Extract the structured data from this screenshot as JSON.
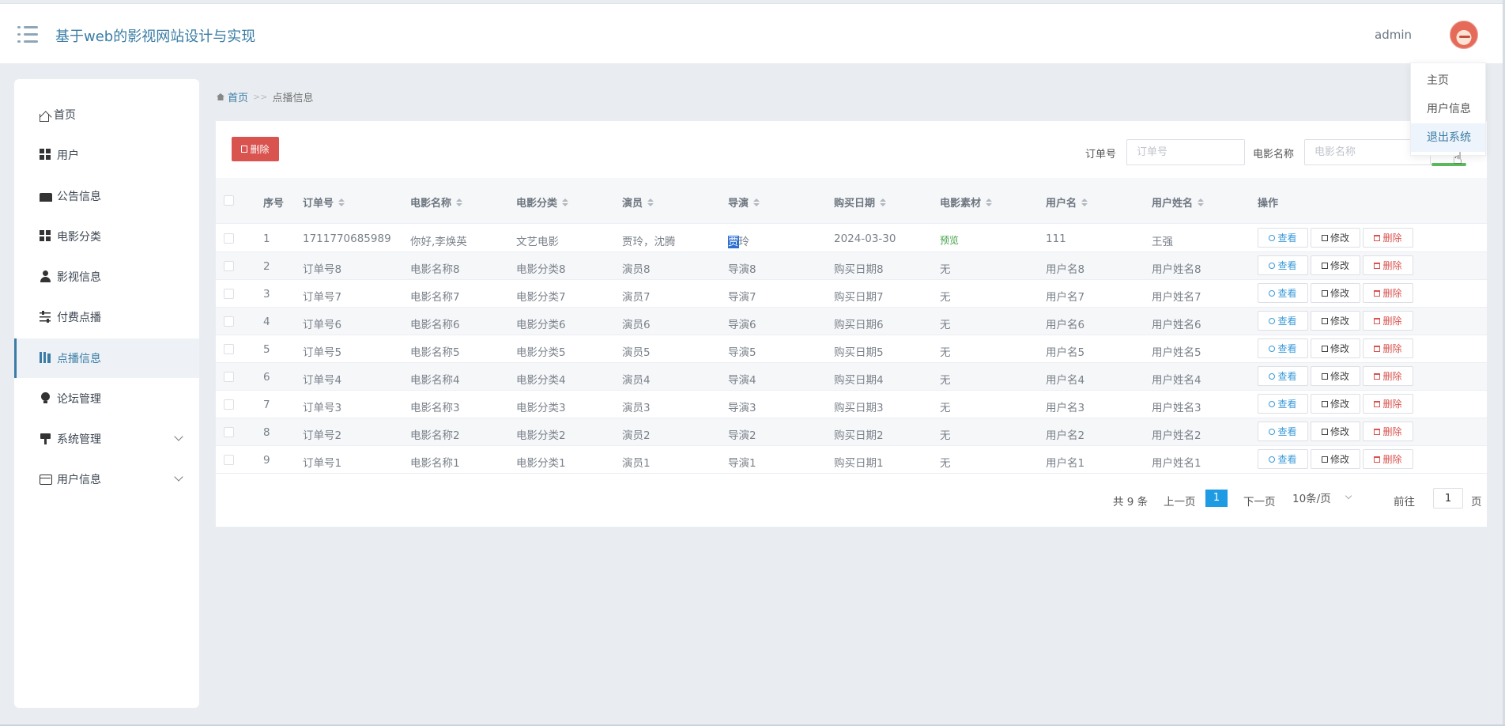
{
  "header": {
    "title": "基于web的影视网站设计与实现",
    "username": "admin"
  },
  "dropdown": {
    "items": [
      "主页",
      "用户信息",
      "退出系统"
    ]
  },
  "sidebar": {
    "items": [
      {
        "label": "首页",
        "icon": "home-icon"
      },
      {
        "label": "用户",
        "icon": "grid-icon"
      },
      {
        "label": "公告信息",
        "icon": "notice-icon"
      },
      {
        "label": "电影分类",
        "icon": "grid-icon"
      },
      {
        "label": "影视信息",
        "icon": "user-icon"
      },
      {
        "label": "付费点播",
        "icon": "sliders-icon"
      },
      {
        "label": "点播信息",
        "icon": "books-icon",
        "active": true
      },
      {
        "label": "论坛管理",
        "icon": "bulb-icon"
      },
      {
        "label": "系统管理",
        "icon": "system-icon",
        "expandable": true
      },
      {
        "label": "用户信息",
        "icon": "wallet-icon",
        "expandable": true
      }
    ]
  },
  "breadcrumb": {
    "home": "首页",
    "separator": ">>",
    "current": "点播信息"
  },
  "toolbar": {
    "delete_label": "删除",
    "order_label": "订单号",
    "order_placeholder": "订单号",
    "movie_label": "电影名称",
    "movie_placeholder": "电影名称"
  },
  "table": {
    "columns": [
      "序号",
      "订单号",
      "电影名称",
      "电影分类",
      "演员",
      "导演",
      "购买日期",
      "电影素材",
      "用户名",
      "用户姓名",
      "操作"
    ],
    "rows": [
      [
        "1",
        "1711770685989",
        "你好,李焕英",
        "文艺电影",
        "贾玲，沈腾",
        "贾玲",
        "2024-03-30",
        "预览",
        "111",
        "王强"
      ],
      [
        "2",
        "订单号8",
        "电影名称8",
        "电影分类8",
        "演员8",
        "导演8",
        "购买日期8",
        "无",
        "用户名8",
        "用户姓名8"
      ],
      [
        "3",
        "订单号7",
        "电影名称7",
        "电影分类7",
        "演员7",
        "导演7",
        "购买日期7",
        "无",
        "用户名7",
        "用户姓名7"
      ],
      [
        "4",
        "订单号6",
        "电影名称6",
        "电影分类6",
        "演员6",
        "导演6",
        "购买日期6",
        "无",
        "用户名6",
        "用户姓名6"
      ],
      [
        "5",
        "订单号5",
        "电影名称5",
        "电影分类5",
        "演员5",
        "导演5",
        "购买日期5",
        "无",
        "用户名5",
        "用户姓名5"
      ],
      [
        "6",
        "订单号4",
        "电影名称4",
        "电影分类4",
        "演员4",
        "导演4",
        "购买日期4",
        "无",
        "用户名4",
        "用户姓名4"
      ],
      [
        "7",
        "订单号3",
        "电影名称3",
        "电影分类3",
        "演员3",
        "导演3",
        "购买日期3",
        "无",
        "用户名3",
        "用户姓名3"
      ],
      [
        "8",
        "订单号2",
        "电影名称2",
        "电影分类2",
        "演员2",
        "导演2",
        "购买日期2",
        "无",
        "用户名2",
        "用户姓名2"
      ],
      [
        "9",
        "订单号1",
        "电影名称1",
        "电影分类1",
        "演员1",
        "导演1",
        "购买日期1",
        "无",
        "用户名1",
        "用户姓名1"
      ]
    ],
    "actions": {
      "view": "查看",
      "edit": "修改",
      "delete": "删除"
    }
  },
  "pagination": {
    "total": "共 9 条",
    "prev": "上一页",
    "current_page": "1",
    "next": "下一页",
    "page_size": "10条/页",
    "goto_label": "前往",
    "goto_value": "1",
    "page_unit": "页"
  },
  "colors": {
    "accent": "#3a7ca5",
    "danger": "#d9534f",
    "page_active": "#1e9be2",
    "preview_green": "#43a047"
  }
}
